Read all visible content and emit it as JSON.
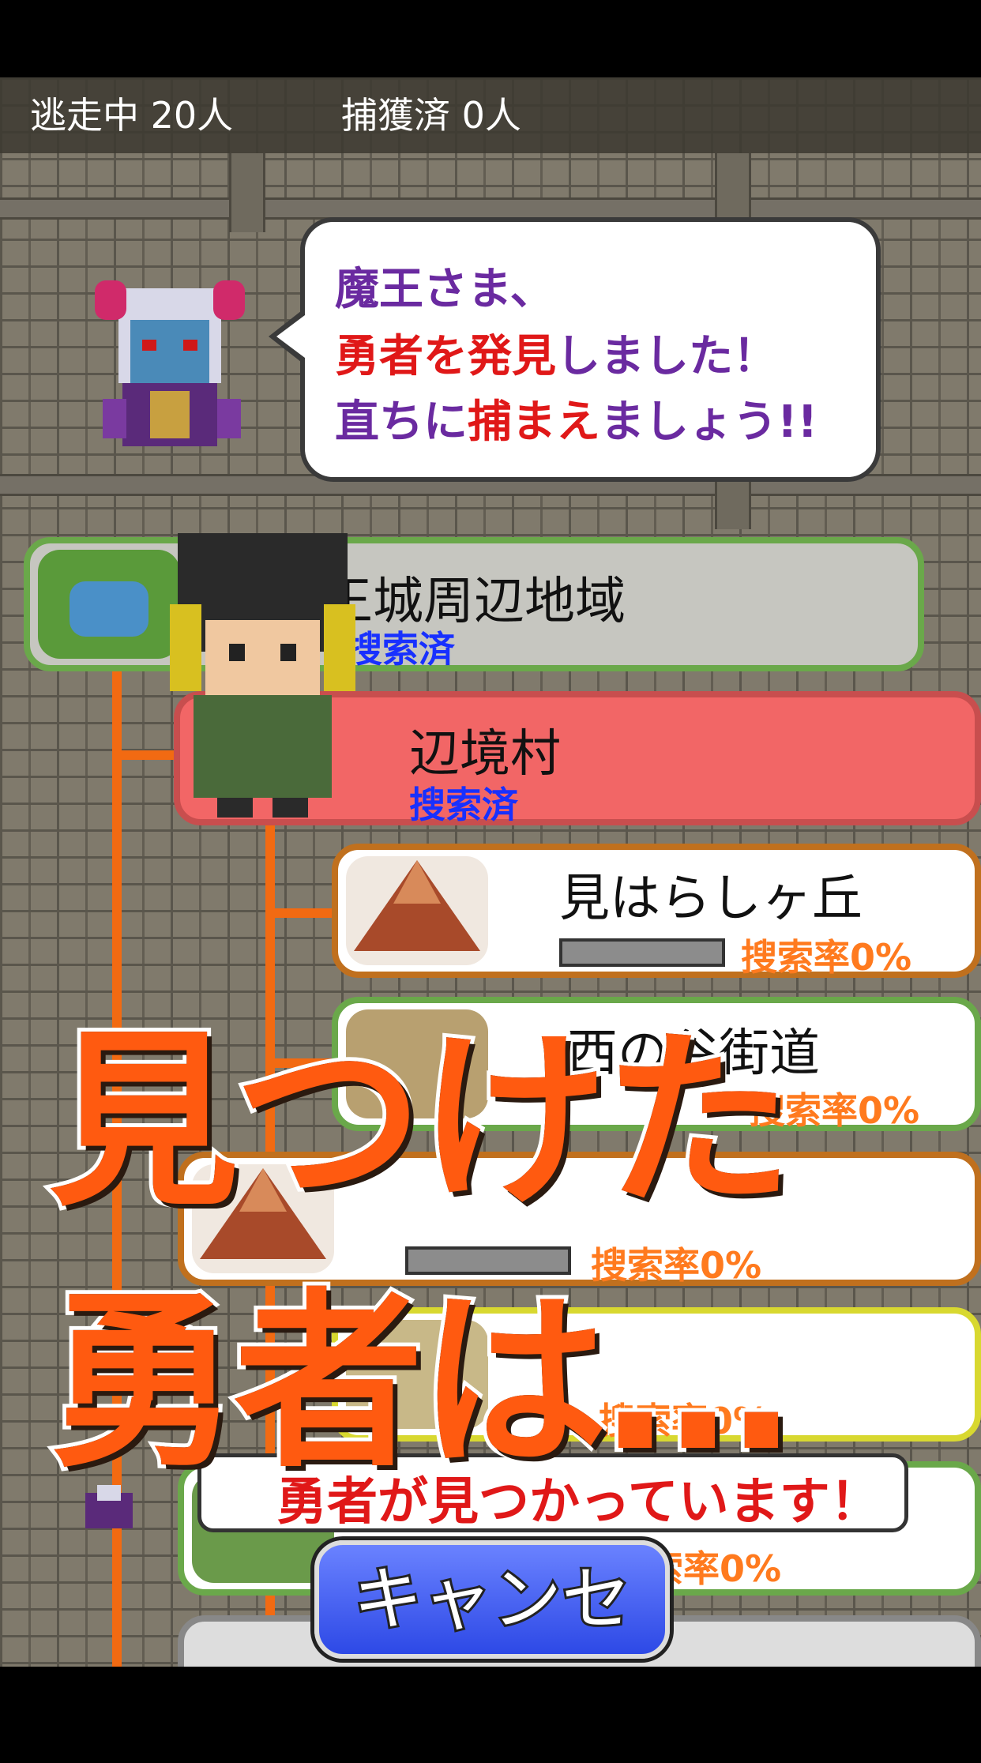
{
  "status": {
    "fleeing": "逃走中 20人",
    "captured": "捕獲済 0人"
  },
  "dialog": {
    "line1": "魔王さま、",
    "line2_red": "勇者を発見",
    "line2_purple": "しました！",
    "line3_purple_a": "直ちに",
    "line3_red": "捕まえ",
    "line3_purple_b": "ましょう!!"
  },
  "locations": [
    {
      "name": "王城周辺地域",
      "status": "搜索済",
      "state": "searched"
    },
    {
      "name": "辺境村",
      "status": "搜索済",
      "state": "searched-current"
    },
    {
      "name": "見はらしヶ丘",
      "status": "搜索率0%",
      "state": "unsearched"
    },
    {
      "name": "西の谷街道",
      "status": "搜索率0%",
      "state": "unsearched"
    },
    {
      "name": "",
      "status": "搜索率0%",
      "state": "unsearched"
    },
    {
      "name": "",
      "status": "搜索率0%",
      "state": "unsearched"
    },
    {
      "name": "",
      "status": "搜索率0%",
      "state": "unsearched"
    }
  ],
  "alert": "勇者が見つかっています！",
  "caption": {
    "line1": "見つけた",
    "line2": "勇者は…"
  },
  "cancel_label": "キャンセル",
  "colors": {
    "accent_orange": "#ff7a1e",
    "route": "#f26a12",
    "searched_blue": "#1830ff",
    "current_row": "#f26666",
    "caption": "#ff5a10"
  }
}
